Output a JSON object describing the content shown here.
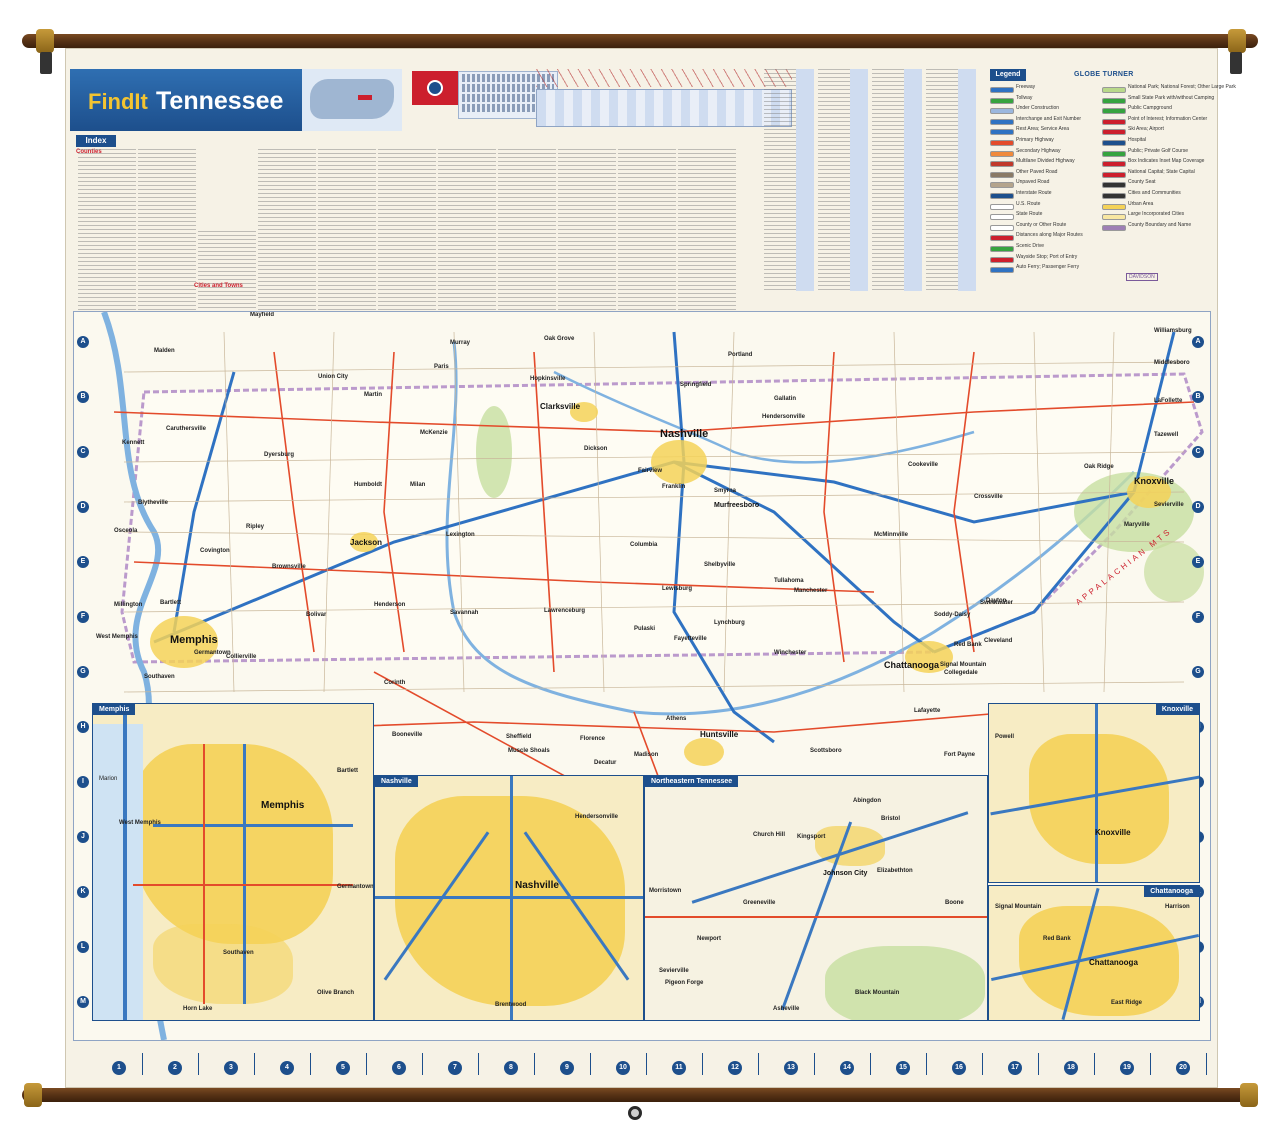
{
  "title": {
    "prefix": "FindIt",
    "state": "Tennessee"
  },
  "brand": "GLOBE TURNER",
  "legend": {
    "title": "Legend",
    "items": [
      {
        "label": "Freeway",
        "color": "#2f72c2"
      },
      {
        "label": "Tollway",
        "color": "#36a33f"
      },
      {
        "label": "Under Construction",
        "color": "#9bb7de"
      },
      {
        "label": "Interchange and Exit Number",
        "color": "#2f72c2"
      },
      {
        "label": "Rest Area; Service Area",
        "color": "#2f72c2"
      },
      {
        "label": "Primary Highway",
        "color": "#e34b2b"
      },
      {
        "label": "Secondary Highway",
        "color": "#f08a3c"
      },
      {
        "label": "Multilane Divided Highway",
        "color": "#c0392b"
      },
      {
        "label": "Other Paved Road",
        "color": "#8a7a66"
      },
      {
        "label": "Unpaved Road",
        "color": "#b4a48c"
      },
      {
        "label": "Interstate Route",
        "color": "#1d4f8c"
      },
      {
        "label": "U.S. Route",
        "color": "#ffffff"
      },
      {
        "label": "State Route",
        "color": "#ffffff"
      },
      {
        "label": "County or Other Route",
        "color": "#ffffff"
      },
      {
        "label": "Distances along Major Routes",
        "color": "#cc1f2d"
      },
      {
        "label": "Scenic Drive",
        "color": "#36a33f"
      },
      {
        "label": "Wayside Stop; Port of Entry",
        "color": "#cc1f2d"
      },
      {
        "label": "Auto Ferry; Passenger Ferry",
        "color": "#2f72c2"
      },
      {
        "label": "National Park; National Forest; Other Large Park",
        "color": "#b9d98a"
      },
      {
        "label": "Small State Park with/without Camping",
        "color": "#36a33f"
      },
      {
        "label": "Public Campground",
        "color": "#36a33f"
      },
      {
        "label": "Point of Interest; Information Center",
        "color": "#cc1f2d"
      },
      {
        "label": "Ski Area; Airport",
        "color": "#cc1f2d"
      },
      {
        "label": "Hospital",
        "color": "#1d4f8c"
      },
      {
        "label": "Public; Private Golf Course",
        "color": "#36a33f"
      },
      {
        "label": "Box Indicates Inset Map Coverage",
        "color": "#cc1f2d"
      },
      {
        "label": "National Capital; State Capital",
        "color": "#cc1f2d"
      },
      {
        "label": "County Seat",
        "color": "#333333"
      },
      {
        "label": "Cities and Communities",
        "color": "#333333"
      },
      {
        "label": "Urban Area",
        "color": "#f4d258"
      },
      {
        "label": "Large Incorporated Cities",
        "color": "#f8e7a2"
      },
      {
        "label": "County Boundary and Name",
        "color": "#9e7fb5"
      }
    ],
    "county_sample": "DAVIDSON"
  },
  "index": {
    "title": "Index",
    "counties_heading": "Counties",
    "cities_heading": "Cities and Towns"
  },
  "map": {
    "grid_letters": [
      "A",
      "B",
      "C",
      "D",
      "E",
      "F",
      "G",
      "H",
      "I",
      "J",
      "K",
      "L",
      "M"
    ],
    "grid_numbers": [
      "1",
      "2",
      "3",
      "4",
      "5",
      "6",
      "7",
      "8",
      "9",
      "10",
      "11",
      "12",
      "13",
      "14",
      "15",
      "16",
      "17",
      "18",
      "19",
      "20"
    ],
    "cities_major": [
      "Nashville",
      "Memphis",
      "Knoxville",
      "Chattanooga",
      "Jackson",
      "Clarksville",
      "Murfreesboro",
      "Huntsville"
    ],
    "cities": [
      "Mayfield",
      "Murray",
      "Union City",
      "Martin",
      "Dyersburg",
      "Humboldt",
      "Paris",
      "McKenzie",
      "Lexington",
      "Henderson",
      "Bolivar",
      "Savannah",
      "Millington",
      "Bartlett",
      "West Memphis",
      "Germantown",
      "Collierville",
      "Southaven",
      "Covington",
      "Ripley",
      "Brownsville",
      "Milan",
      "Oak Grove",
      "Hopkinsville",
      "Portland",
      "Springfield",
      "Gallatin",
      "Hendersonville",
      "Franklin",
      "Smyrna",
      "Columbia",
      "Lewisburg",
      "Shelbyville",
      "Tullahoma",
      "Manchester",
      "McMinnville",
      "Cookeville",
      "Crossville",
      "Dayton",
      "Cleveland",
      "Collegedale",
      "Oak Ridge",
      "Maryville",
      "Sevierville",
      "Middlesboro",
      "LaFollette",
      "Williamsburg",
      "Lawrenceburg",
      "Pulaski",
      "Fayetteville",
      "Lynchburg",
      "Winchester",
      "Decatur",
      "Florence",
      "Sheffield",
      "Muscle Shoals",
      "Athens",
      "Madison",
      "Scottsboro",
      "Corinth",
      "Booneville",
      "Dalton",
      "Fort Payne",
      "Rossville",
      "Sweetwater",
      "Tazewell",
      "Kennett",
      "Blytheville",
      "Osceola",
      "Malden",
      "Caruthersville",
      "Dickson",
      "Fairview",
      "Lafayette",
      "Calhoun",
      "Soddy-Daisy",
      "Red Bank",
      "Signal Mountain"
    ],
    "region_label": "APPALACHIAN MTS"
  },
  "insets": {
    "memphis": {
      "title": "Memphis",
      "labels": [
        "Memphis",
        "Bartlett",
        "West Memphis",
        "Germantown",
        "Southaven",
        "Olive Branch",
        "Horn Lake",
        "Marion"
      ]
    },
    "nashville": {
      "title": "Nashville",
      "labels": [
        "Nashville",
        "Hendersonville",
        "Brentwood"
      ]
    },
    "northeast": {
      "title": "Northeastern Tennessee",
      "labels": [
        "Abingdon",
        "Bristol",
        "Kingsport",
        "Church Hill",
        "Johnson City",
        "Elizabethton",
        "Greeneville",
        "Morristown",
        "Newport",
        "Sevierville",
        "Pigeon Forge",
        "Boone",
        "Asheville",
        "Black Mountain"
      ]
    },
    "knoxville": {
      "title": "Knoxville",
      "labels": [
        "Powell",
        "Knoxville"
      ]
    },
    "chattanooga": {
      "title": "Chattanooga",
      "labels": [
        "Signal Mountain",
        "Red Bank",
        "Chattanooga",
        "Harrison",
        "East Ridge"
      ]
    }
  }
}
